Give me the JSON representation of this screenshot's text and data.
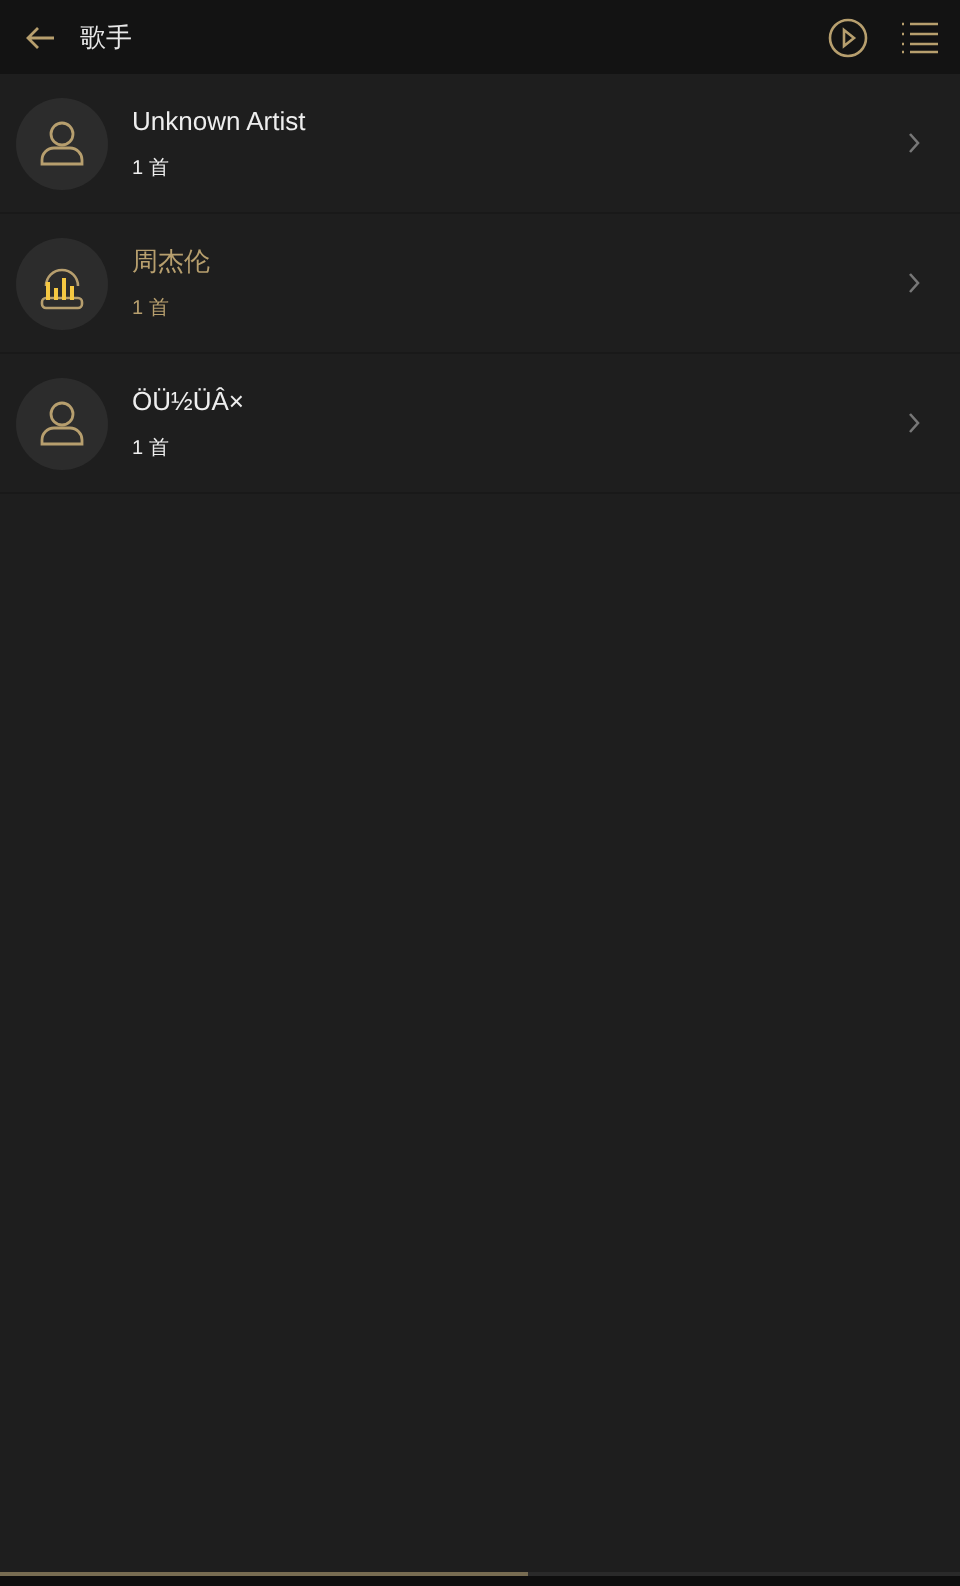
{
  "header": {
    "title": "歌手"
  },
  "artists": [
    {
      "name": "Unknown Artist",
      "count": "1 首",
      "playing": false
    },
    {
      "name": "周杰伦",
      "count": "1 首",
      "playing": true
    },
    {
      "name": "ÖÜ½ÜÂ×",
      "count": "1 首",
      "playing": false
    }
  ],
  "playback": {
    "level": 0.55
  }
}
